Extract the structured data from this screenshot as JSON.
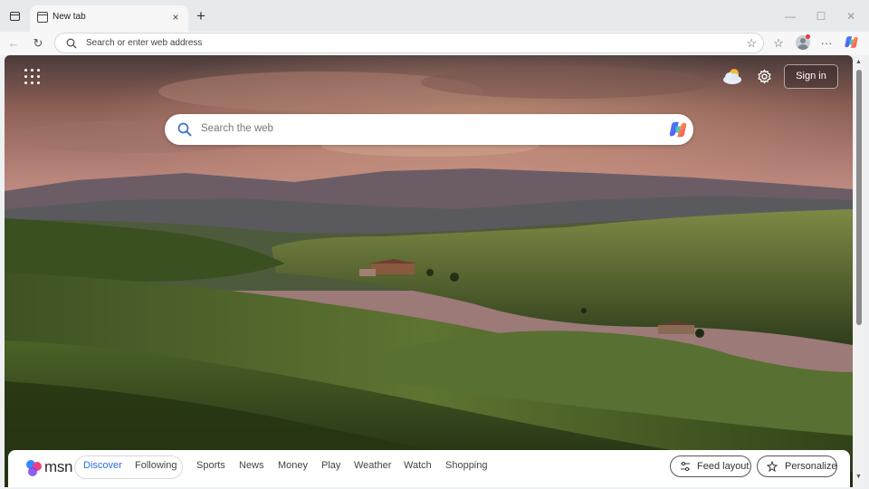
{
  "browser": {
    "tab": {
      "title": "New tab",
      "close_icon": "×"
    },
    "new_tab_icon": "+",
    "window_controls": {
      "minimize": "—",
      "maximize": "☐",
      "close": "✕"
    },
    "back_icon": "←",
    "reload_icon": "↻",
    "address_placeholder": "Search or enter web address",
    "favorite_icon": "☆",
    "favorites_icon": "☆",
    "more_icon": "···"
  },
  "page": {
    "sign_in": "Sign in",
    "search_placeholder": "Search the web"
  },
  "feed": {
    "brand": "msn",
    "tabs": [
      "Discover",
      "Following"
    ],
    "active_tab": "Discover",
    "categories": [
      "Sports",
      "News",
      "Money",
      "Play",
      "Weather",
      "Watch",
      "Shopping"
    ],
    "feed_layout_label": "Feed layout",
    "personalize_label": "Personalize"
  },
  "colors": {
    "accent": "#2b6fdc",
    "tabstrip": "#e7eaed",
    "toolbar": "#f7f7f7"
  }
}
